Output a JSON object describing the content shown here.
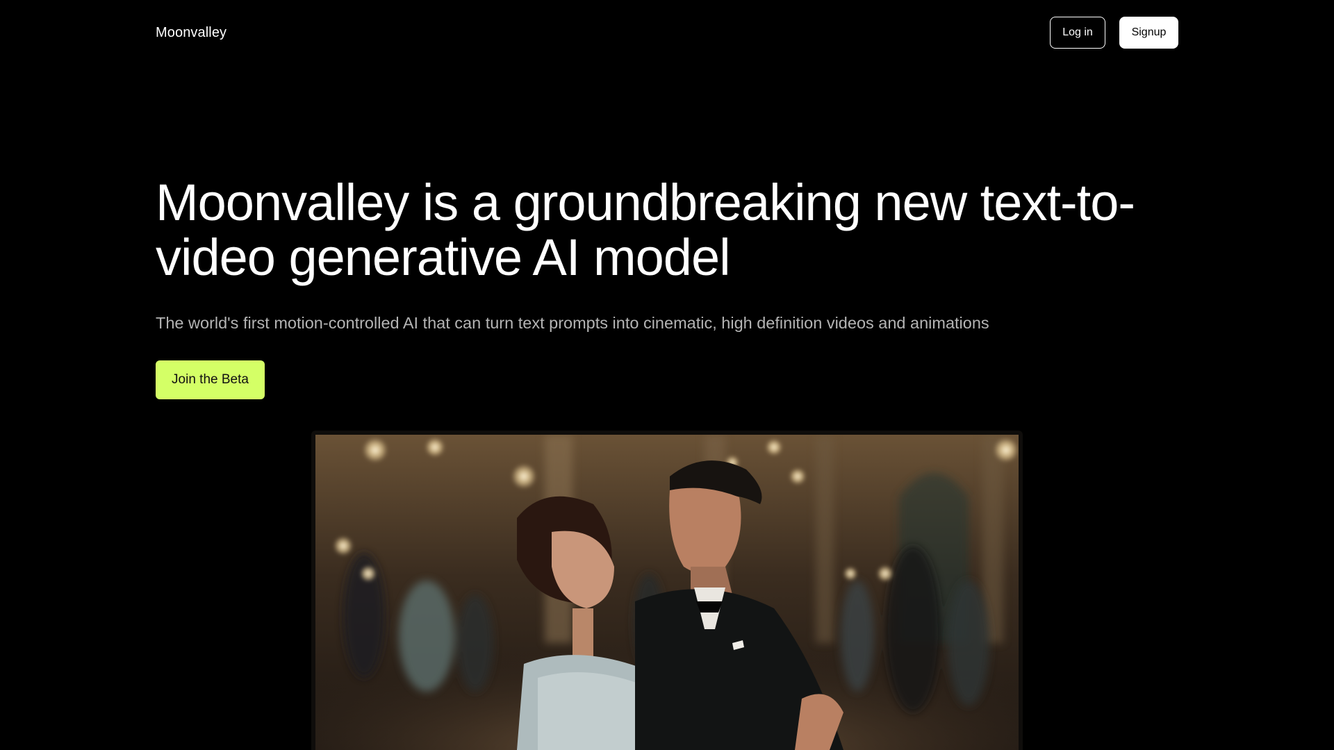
{
  "header": {
    "brand": "Moonvalley",
    "login_label": "Log in",
    "signup_label": "Signup"
  },
  "hero": {
    "title": "Moonvalley is a groundbreaking new text-to-video generative AI model",
    "subtitle": "The world's first motion-controlled AI that can turn text prompts into cinematic, high definition videos and animations",
    "cta_label": "Join the Beta"
  },
  "colors": {
    "background": "#000000",
    "accent": "#d4ff66",
    "subtitle": "#b4b4b4"
  },
  "media": {
    "icon": "video-still-icon"
  }
}
